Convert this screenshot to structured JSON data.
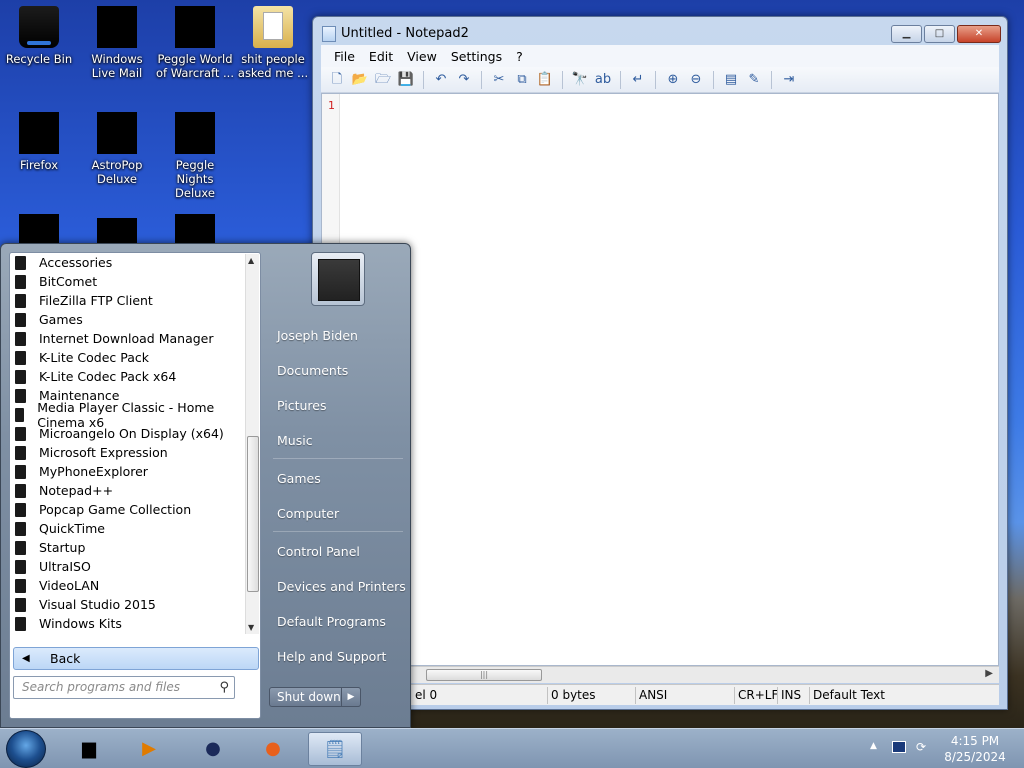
{
  "desktop": {
    "icons": [
      {
        "label": "Recycle Bin"
      },
      {
        "label": "Windows Live Mail"
      },
      {
        "label": "Peggle World of Warcraft ..."
      },
      {
        "label": "shit people asked me ..."
      },
      {
        "label": "Firefox"
      },
      {
        "label": "AstroPop Deluxe"
      },
      {
        "label": "Peggle Nights Deluxe"
      }
    ]
  },
  "notepad": {
    "title": "Untitled - Notepad2",
    "menu": [
      "File",
      "Edit",
      "View",
      "Settings",
      "?"
    ],
    "line_number": "1",
    "status": {
      "line": "el 0",
      "size": "0 bytes",
      "encoding": "ANSI",
      "eol": "CR+LF",
      "ins": "INS",
      "scheme": "Default Text"
    }
  },
  "start_menu": {
    "programs": [
      "Accessories",
      "BitComet",
      "FileZilla FTP Client",
      "Games",
      "Internet Download Manager",
      "K-Lite Codec Pack",
      "K-Lite Codec Pack x64",
      "Maintenance",
      "Media Player Classic - Home Cinema x6",
      "Microangelo On Display (x64)",
      "Microsoft Expression",
      "MyPhoneExplorer",
      "Notepad++",
      "Popcap Game Collection",
      "QuickTime",
      "Startup",
      "UltraISO",
      "VideoLAN",
      "Visual Studio 2015",
      "Windows Kits"
    ],
    "back_label": "Back",
    "search_placeholder": "Search programs and files",
    "right_items": [
      "Joseph Biden",
      "Documents",
      "Pictures",
      "Music",
      "Games",
      "Computer",
      "Control Panel",
      "Devices and Printers",
      "Default Programs",
      "Help and Support"
    ],
    "shutdown_label": "Shut down"
  },
  "taskbar": {
    "time": "4:15 PM",
    "date": "8/25/2024"
  }
}
